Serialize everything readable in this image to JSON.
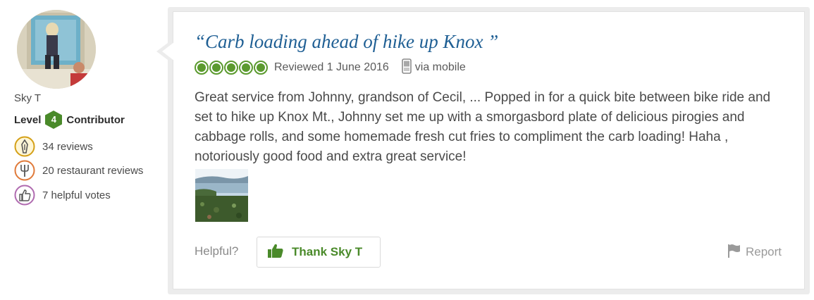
{
  "member": {
    "username": "Sky T",
    "level_prefix": "Level",
    "level_number": "4",
    "level_suffix": "Contributor",
    "badges": [
      {
        "icon": "reviews-pen-icon",
        "label": "34 reviews",
        "color": "#d4a017"
      },
      {
        "icon": "fork-restaurant-icon",
        "label": "20 restaurant reviews",
        "color": "#e07a3a"
      },
      {
        "icon": "thumbs-up-icon",
        "label": "7 helpful votes",
        "color": "#b06bb0"
      }
    ]
  },
  "review": {
    "title": "“Carb loading ahead of hike up Knox ”",
    "rating": 5,
    "rating_max": 5,
    "reviewed_date": "Reviewed 1 June 2016",
    "via": "via mobile",
    "body": "Great service from Johnny, grandson of Cecil, ... Popped in for a quick bite between bike ride and set to hike up Knox Mt., Johnny set me up with a smorgasbord plate of delicious pirogies and cabbage rolls, and some homemade fresh cut fries to compliment the carb loading! Haha , notoriously good food and extra great service!"
  },
  "actions": {
    "helpful_label": "Helpful?",
    "thank_label": "Thank Sky T",
    "report_label": "Report"
  },
  "colors": {
    "title": "#1f5f94",
    "rating_green": "#5b9a2e",
    "level_badge": "#4a8a2a"
  }
}
